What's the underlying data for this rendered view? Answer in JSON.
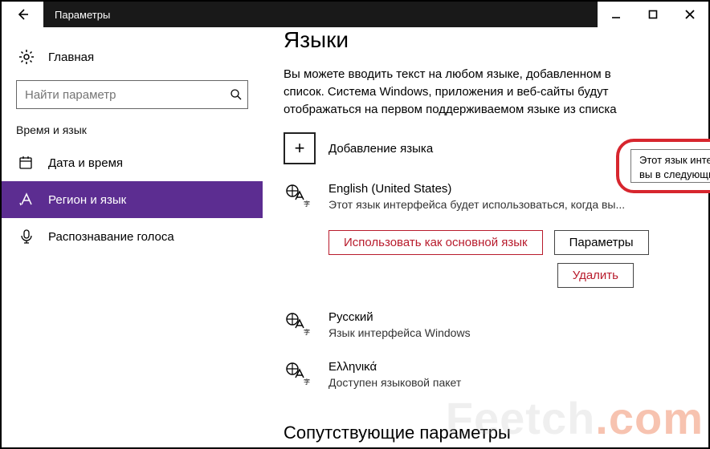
{
  "titlebar": {
    "title": "Параметры"
  },
  "sidebar": {
    "home": "Главная",
    "search_placeholder": "Найти параметр",
    "section": "Время и язык",
    "items": [
      {
        "label": "Дата и время"
      },
      {
        "label": "Регион и язык"
      },
      {
        "label": "Распознавание голоса"
      }
    ]
  },
  "content": {
    "heading": "Языки",
    "intro": "Вы можете вводить текст на любом языке, добавленном в список. Система Windows, приложения и веб-сайты будут отображаться на первом поддерживаемом языке из списка",
    "add_label": "Добавление языка",
    "tooltip": "Этот язык интерфейса будет использоваться, когда вы в следующий раз войдёте в систему",
    "languages": [
      {
        "name": "English (United States)",
        "sub": "Этот язык интерфейса будет использоваться, когда вы..."
      },
      {
        "name": "Русский",
        "sub": "Язык интерфейса Windows"
      },
      {
        "name": "Ελληνικά",
        "sub": "Доступен языковой пакет"
      }
    ],
    "buttons": {
      "set_default": "Использовать как основной язык",
      "options": "Параметры",
      "remove": "Удалить"
    },
    "related_heading": "Сопутствующие параметры"
  },
  "watermark": {
    "a": "Feetch",
    "b": ".com"
  }
}
